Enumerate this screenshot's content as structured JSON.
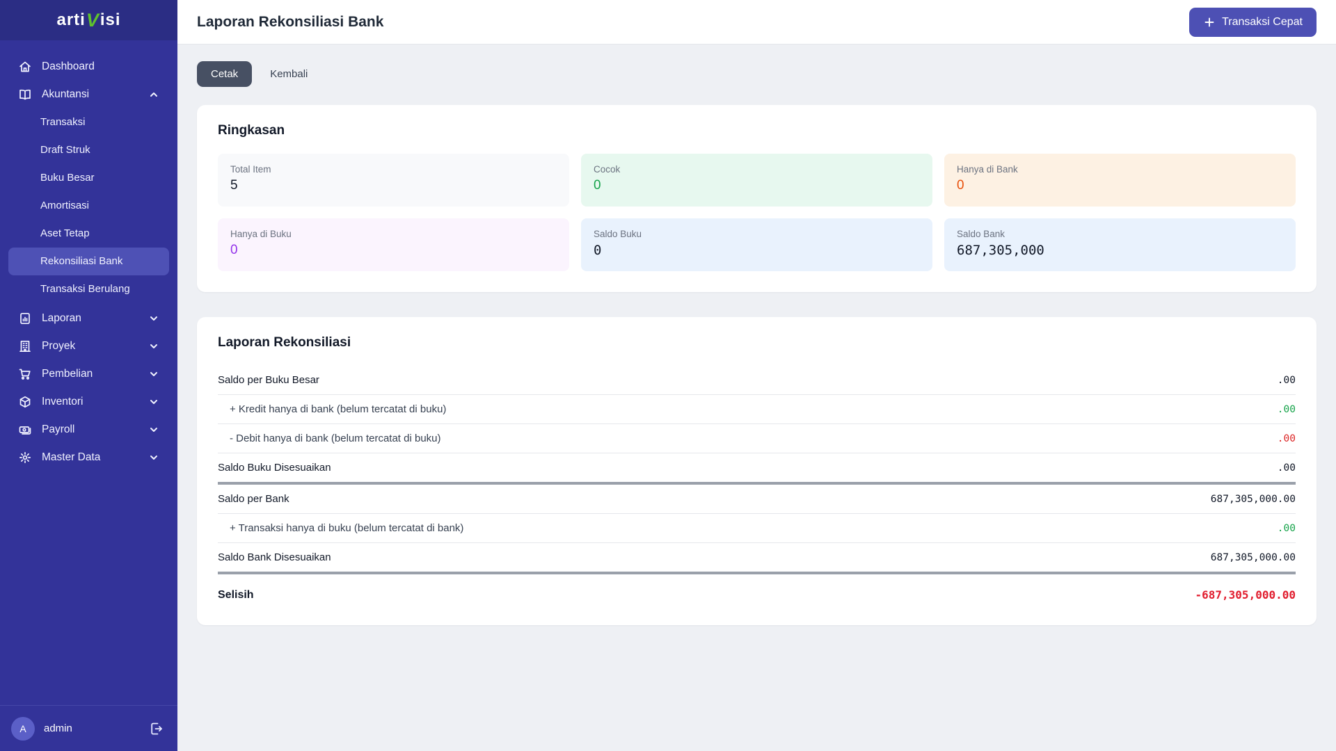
{
  "logo": {
    "prefix": "arti",
    "accent": "V",
    "suffix": "isi"
  },
  "sidebar": {
    "items": {
      "dashboard": {
        "label": "Dashboard"
      },
      "akuntansi": {
        "label": "Akuntansi",
        "expanded": true
      },
      "laporan": {
        "label": "Laporan"
      },
      "proyek": {
        "label": "Proyek"
      },
      "pembelian": {
        "label": "Pembelian"
      },
      "inventori": {
        "label": "Inventori"
      },
      "payroll": {
        "label": "Payroll"
      },
      "masterdata": {
        "label": "Master Data"
      }
    },
    "akuntansi_children": {
      "transaksi": "Transaksi",
      "draft_struk": "Draft Struk",
      "buku_besar": "Buku Besar",
      "amortisasi": "Amortisasi",
      "aset_tetap": "Aset Tetap",
      "rekonsiliasi_bank": "Rekonsiliasi Bank",
      "transaksi_berulang": "Transaksi Berulang"
    },
    "active_item": "Rekonsiliasi Bank",
    "user": {
      "initial": "A",
      "name": "admin"
    }
  },
  "header": {
    "title": "Laporan Rekonsiliasi Bank",
    "quick_transaction_label": "Transaksi Cepat"
  },
  "toolbar": {
    "print_label": "Cetak",
    "back_label": "Kembali"
  },
  "summary": {
    "title": "Ringkasan",
    "tiles": {
      "total_item": {
        "label": "Total Item",
        "value": "5"
      },
      "cocok": {
        "label": "Cocok",
        "value": "0"
      },
      "hanya_bank": {
        "label": "Hanya di Bank",
        "value": "0"
      },
      "hanya_buku": {
        "label": "Hanya di Buku",
        "value": "0"
      },
      "saldo_buku": {
        "label": "Saldo Buku",
        "value": "0"
      },
      "saldo_bank": {
        "label": "Saldo Bank",
        "value": "687,305,000"
      }
    }
  },
  "report": {
    "title": "Laporan Rekonsiliasi",
    "rows": {
      "saldo_buku_besar": {
        "label": "Saldo per Buku Besar",
        "value": ".00"
      },
      "kredit_hanya_bank": {
        "label": "+ Kredit hanya di bank (belum tercatat di buku)",
        "value": ".00"
      },
      "debit_hanya_bank": {
        "label": "- Debit hanya di bank (belum tercatat di buku)",
        "value": ".00"
      },
      "saldo_buku_adjusted": {
        "label": "Saldo Buku Disesuaikan",
        "value": ".00"
      },
      "saldo_per_bank": {
        "label": "Saldo per Bank",
        "value": "687,305,000.00"
      },
      "transaksi_hanya_buku": {
        "label": "+ Transaksi hanya di buku (belum tercatat di bank)",
        "value": ".00"
      },
      "saldo_bank_adjusted": {
        "label": "Saldo Bank Disesuaikan",
        "value": "687,305,000.00"
      },
      "selisih": {
        "label": "Selisih",
        "value": "-687,305,000.00"
      }
    }
  },
  "colors": {
    "sidebar": "#333399",
    "sidebar_top": "#2b2d84",
    "active_item": "#4e51b5",
    "accent_button": "#4d50b4",
    "print_button": "#475063",
    "positive": "#16a34a",
    "negative": "#dc2626",
    "orange": "#e8500b",
    "purple": "#9333ea",
    "logo_accent": "#5fc22d"
  }
}
